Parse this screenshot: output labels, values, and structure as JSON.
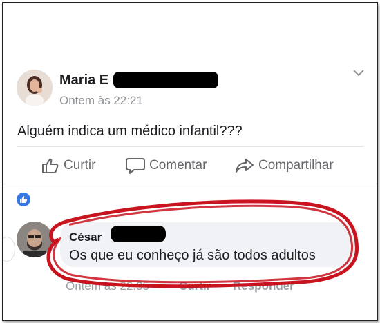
{
  "post": {
    "author": "Maria E",
    "timestamp": "Ontem às 22:21",
    "text": "Alguém indica um médico infantil???",
    "menu_icon": "chevron-down-icon"
  },
  "actions": {
    "like": "Curtir",
    "comment": "Comentar",
    "share": "Compartilhar"
  },
  "comment": {
    "author": "César",
    "text": "Os que eu conheço já são todos adultos",
    "timestamp": "Ontem às 22:35",
    "like": "Curtir",
    "reply": "Responder"
  },
  "colors": {
    "like_badge": "#3578e5",
    "highlight_circle": "#c8141e",
    "muted_text": "#8e9195"
  }
}
